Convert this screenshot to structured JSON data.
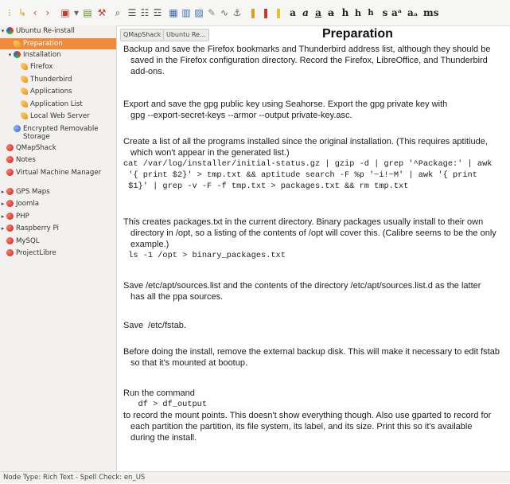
{
  "toolbar": {
    "buttons": [
      {
        "name": "add-node-icon",
        "glyph": "⁝",
        "color": "#d4a017"
      },
      {
        "name": "add-subnode-icon",
        "glyph": "↳",
        "color": "#d4a017"
      },
      {
        "name": "go-back-icon",
        "glyph": "‹",
        "color": "#e0472e"
      },
      {
        "name": "go-forward-icon",
        "glyph": "›",
        "color": "#e0472e"
      },
      {
        "name": "save-icon",
        "glyph": "▣",
        "color": "#c7392b"
      },
      {
        "name": "save-dropdown-icon",
        "glyph": "▾",
        "color": "#666"
      },
      {
        "name": "export-icon",
        "glyph": "▤",
        "color": "#6a8f3a"
      },
      {
        "name": "tools-icon",
        "glyph": "⚒",
        "color": "#b53a2f"
      },
      {
        "name": "search-icon",
        "glyph": "⌕",
        "color": "#444"
      },
      {
        "name": "bulleted-list-icon",
        "glyph": "☰",
        "color": "#555"
      },
      {
        "name": "numbered-list-icon",
        "glyph": "☷",
        "color": "#555"
      },
      {
        "name": "todo-list-icon",
        "glyph": "☲",
        "color": "#555"
      },
      {
        "name": "insert-table-icon",
        "glyph": "▦",
        "color": "#3d6bb3"
      },
      {
        "name": "insert-codebox-icon",
        "glyph": "▥",
        "color": "#3d6bb3"
      },
      {
        "name": "insert-image-icon",
        "glyph": "▨",
        "color": "#3d6bb3"
      },
      {
        "name": "insert-file-icon",
        "glyph": "✎",
        "color": "#888"
      },
      {
        "name": "insert-link-icon",
        "glyph": "∿",
        "color": "#666"
      },
      {
        "name": "insert-anchor-icon",
        "glyph": "⚓",
        "color": "#666"
      },
      {
        "name": "text-color-icon",
        "glyph": "❚",
        "color": "#d8a11a"
      },
      {
        "name": "background-color-icon",
        "glyph": "❚",
        "color": "#c4392f"
      },
      {
        "name": "highlight-icon",
        "glyph": "❚",
        "color": "#e0c428"
      },
      {
        "name": "bold-button",
        "glyph": "a",
        "color": "#222"
      },
      {
        "name": "italic-button",
        "glyph": "a",
        "color": "#222"
      },
      {
        "name": "underline-button",
        "glyph": "a",
        "color": "#222"
      },
      {
        "name": "strikethrough-button",
        "glyph": "a",
        "color": "#222"
      },
      {
        "name": "heading1-button",
        "glyph": "h",
        "color": "#222"
      },
      {
        "name": "heading2-button",
        "glyph": "h",
        "color": "#222"
      },
      {
        "name": "heading3-button",
        "glyph": "h",
        "color": "#222"
      },
      {
        "name": "small-button",
        "glyph": "s",
        "color": "#222"
      },
      {
        "name": "superscript-button",
        "glyph": "aᵃ",
        "color": "#222"
      },
      {
        "name": "subscript-button",
        "glyph": "aₐ",
        "color": "#222"
      },
      {
        "name": "monospace-button",
        "glyph": "ms",
        "color": "#222"
      }
    ]
  },
  "tree": [
    {
      "label": "Ubuntu Re-install",
      "expanded": true,
      "icon": "multi",
      "level": 0
    },
    {
      "label": "Preparation",
      "expanded": false,
      "icon": "leaf",
      "level": 1,
      "selected": true
    },
    {
      "label": "Installation",
      "expanded": true,
      "icon": "multi",
      "level": 1
    },
    {
      "label": "Firefox",
      "icon": "leaf",
      "level": 2
    },
    {
      "label": "Thunderbird",
      "icon": "leaf",
      "level": 2
    },
    {
      "label": "Applications",
      "icon": "leaf",
      "level": 2
    },
    {
      "label": "Application List",
      "icon": "leaf",
      "level": 2
    },
    {
      "label": "Local Web Server",
      "icon": "leaf",
      "level": 2
    },
    {
      "label": "Encrypted Removable Storage",
      "icon": "blue",
      "level": 1
    },
    {
      "label": "QMapShack",
      "icon": "red",
      "level": 0
    },
    {
      "label": "Notes",
      "icon": "red",
      "level": 0
    },
    {
      "label": "Virtual Machine Manager",
      "icon": "red",
      "level": 0
    },
    {
      "label": "GPS Maps",
      "icon": "red",
      "level": 0,
      "collapsed": true
    },
    {
      "label": "Joomla",
      "icon": "red",
      "level": 0,
      "collapsed": true
    },
    {
      "label": "PHP",
      "icon": "red",
      "level": 0,
      "collapsed": true
    },
    {
      "label": "Raspberry Pi",
      "icon": "red",
      "level": 0,
      "collapsed": true
    },
    {
      "label": "MySQL",
      "icon": "red",
      "level": 0
    },
    {
      "label": "ProjectLibre",
      "icon": "red",
      "level": 0
    }
  ],
  "tabs": [
    "QMapShack",
    "Ubuntu Re..."
  ],
  "node_title": "Preparation",
  "content": [
    {
      "lines": [
        {
          "t": "Backup and save the Firefox bookmarks and Thunderbird address list, although they should be",
          "ind": false
        },
        {
          "t": "saved in the Firefox configuration directory. Record the Firefox, LibreOffice, and Thunderbird",
          "ind": true
        },
        {
          "t": "add-ons.",
          "ind": true
        }
      ]
    },
    {
      "lines": [
        {
          "t": "Export and save the gpg public key using Seahorse. Export the gpg private key with",
          "ind": false
        },
        {
          "t": "gpg --export-secret-keys --armor --output private-key.asc.",
          "ind": true
        }
      ]
    },
    {
      "lines": [
        {
          "t": "Create a list of all the programs installed since the original installation. (This requires aptitiude,",
          "ind": false
        },
        {
          "t": "which won't appear in the generated list.)",
          "ind": true
        },
        {
          "t": "cat /var/log/installer/initial-status.gz | gzip -d | grep '^Package:' | awk",
          "ind": false,
          "mono": true
        },
        {
          "t": " '{ print $2}' > tmp.txt && aptitude search -F %p '~i!~M' | awk '{ print",
          "ind": false,
          "mono": true
        },
        {
          "t": " $1}' | grep -v -F -f tmp.txt > packages.txt && rm tmp.txt",
          "ind": false,
          "mono": true
        }
      ]
    },
    {
      "lines": [
        {
          "t": "This creates packages.txt in the current directory. Binary packages usually install to their own",
          "ind": false
        },
        {
          "t": "directory in /opt, so a listing of the contents of /opt will cover this. (Calibre seems to be the only",
          "ind": true
        },
        {
          "t": "example.)",
          "ind": true
        },
        {
          "t": " ls -1 /opt > binary_packages.txt",
          "ind": false,
          "mono": true
        }
      ]
    },
    {
      "lines": [
        {
          "t": "Save /etc/apt/sources.list and the contents of the directory /etc/apt/sources.list.d as the latter",
          "ind": false
        },
        {
          "t": "has all the ppa sources.",
          "ind": true
        }
      ]
    },
    {
      "lines": [
        {
          "t": "Save  /etc/fstab.",
          "ind": false
        }
      ]
    },
    {
      "lines": [
        {
          "t": "Before doing the install, remove the external backup disk. This will make it necessary to edit fstab",
          "ind": false
        },
        {
          "t": "so that it's mounted at bootup.",
          "ind": true
        }
      ]
    },
    {
      "lines": [
        {
          "t": "Run the command",
          "ind": false
        },
        {
          "t": "   df > df_output",
          "ind": false,
          "mono": true
        },
        {
          "t": "to record the mount points. This doesn't show everything though. Also use gparted to record for",
          "ind": false
        },
        {
          "t": "each partition the partition, its file system, its label, and its size. Print this so it's available",
          "ind": true
        },
        {
          "t": "during the install.",
          "ind": true
        }
      ]
    }
  ],
  "status_bar": "Node Type: Rich Text  -  Spell Check: en_US",
  "colors": {
    "selection": "#f08a3c",
    "sidebar_bg": "#f2f1ef"
  }
}
